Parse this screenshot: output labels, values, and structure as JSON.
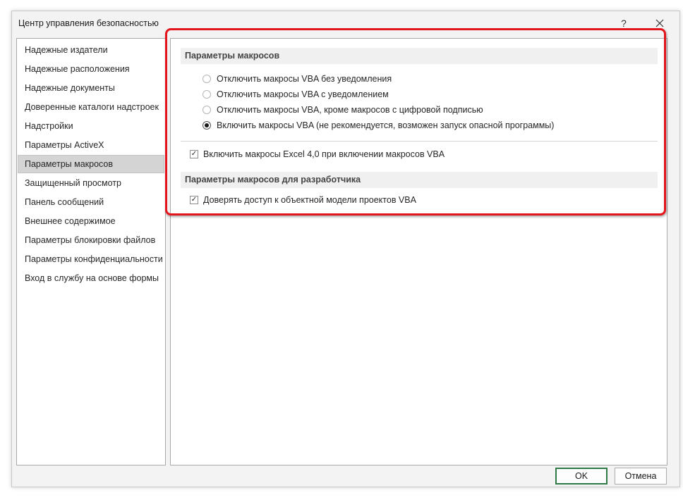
{
  "window": {
    "title": "Центр управления безопасностью",
    "help_label": "?",
    "close_label": "✕"
  },
  "sidebar": {
    "items": [
      {
        "label": "Надежные издатели"
      },
      {
        "label": "Надежные расположения"
      },
      {
        "label": "Надежные документы"
      },
      {
        "label": "Доверенные каталоги надстроек"
      },
      {
        "label": "Надстройки"
      },
      {
        "label": "Параметры ActiveX"
      },
      {
        "label": "Параметры макросов",
        "selected": true
      },
      {
        "label": "Защищенный просмотр"
      },
      {
        "label": "Панель сообщений"
      },
      {
        "label": "Внешнее содержимое"
      },
      {
        "label": "Параметры блокировки файлов"
      },
      {
        "label": "Параметры конфиденциальности"
      },
      {
        "label": "Вход в службу на основе формы"
      }
    ]
  },
  "macro_settings": {
    "header": "Параметры макросов",
    "options": [
      {
        "label": "Отключить макросы VBA без уведомления",
        "selected": false
      },
      {
        "label": "Отключить макросы VBA с уведомлением",
        "selected": false
      },
      {
        "label": "Отключить макросы VBA, кроме макросов с цифровой подписью",
        "selected": false
      },
      {
        "label": "Включить макросы VBA (не рекомендуется, возможен запуск опасной программы)",
        "selected": true
      }
    ],
    "excel4_checkbox": {
      "label": "Включить макросы Excel 4,0 при включении макросов VBA",
      "checked": true
    }
  },
  "developer_settings": {
    "header": "Параметры макросов для разработчика",
    "vba_trust_checkbox": {
      "label": "Доверять доступ к объектной модели проектов VBA",
      "checked": true
    }
  },
  "buttons": {
    "ok": "OK",
    "cancel": "Отмена"
  },
  "colors": {
    "highlight": "#e3141b",
    "ok_border": "#2e7a46",
    "selected_item": "#d4d4d4"
  },
  "icons": {
    "checkmark": "✓"
  }
}
